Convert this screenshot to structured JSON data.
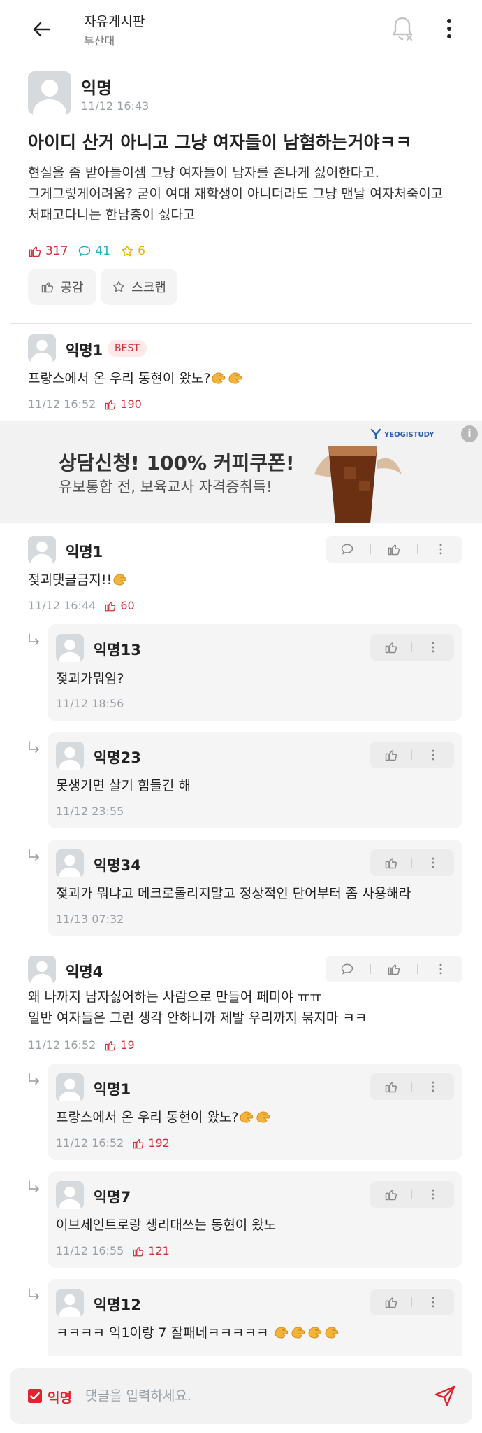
{
  "header": {
    "title": "자유게시판",
    "subtitle": "부산대"
  },
  "post": {
    "author": "익명",
    "time": "11/12 16:43",
    "title": "아이디 산거 아니고 그냥 여자들이 남혐하는거야ㅋㅋ",
    "body": "현실을 좀 받아들이셈 그냥 여자들이 남자를 존나게 싫어한다고.\n그게그렇게어려움? 굳이 여대 재학생이 아니더라도 그냥 맨날 여자처죽이고\n처패고다니는 한남충이 싫다고",
    "likes": "317",
    "comments": "41",
    "scraps": "6",
    "like_button": "공감",
    "scrap_button": "스크랩"
  },
  "best_comment": {
    "author": "익명1",
    "badge": "BEST",
    "text": "프랑스에서 온 우리 동현이 왔노?",
    "time": "11/12 16:52",
    "likes": "190"
  },
  "ad": {
    "title": "상담신청! 100% 커피쿠폰!",
    "subtitle": "유보통합 전, 보육교사 자격증취득!",
    "brand": "YEOGISTUDY",
    "info": "i"
  },
  "comments": [
    {
      "author": "익명1",
      "text": "젖괴댓글금지!!",
      "time": "11/12 16:44",
      "likes": "60",
      "replies": [
        {
          "author": "익명13",
          "text": "젖괴가뭐임?",
          "time": "11/12 18:56"
        },
        {
          "author": "익명23",
          "text": "못생기면 살기 힘들긴 해",
          "time": "11/12 23:55"
        },
        {
          "author": "익명34",
          "text": "젖괴가 뭐냐고 메크로돌리지말고 정상적인 단어부터 좀 사용해라",
          "time": "11/13 07:32"
        }
      ]
    },
    {
      "author": "익명4",
      "text": "왜 나까지 남자싫어하는 사람으로 만들어 페미야 ㅠㅠ\n일반 여자들은 그런 생각 안하니까 제발 우리까지 묶지마 ㅋㅋ",
      "time": "11/12 16:52",
      "likes": "19",
      "replies": [
        {
          "author": "익명1",
          "text": "프랑스에서 온 우리 동현이 왔노?",
          "time": "11/12 16:52",
          "likes": "192"
        },
        {
          "author": "익명7",
          "text": "이브세인트로랑 생리대쓰는 동현이 왔노",
          "time": "11/12 16:55",
          "likes": "121"
        },
        {
          "author": "익명12",
          "text": "ㅋㅋㅋㅋ 익1이랑 7 잘패네ㅋㅋㅋㅋㅋ"
        }
      ]
    }
  ],
  "compose": {
    "anonymous_label": "익명",
    "placeholder": "댓글을 입력하세요."
  },
  "colors": {
    "accent_red": "#e0242f",
    "like_red": "#d0303a",
    "comment_teal": "#1fb3c2",
    "scrap_yellow": "#e8b400"
  }
}
